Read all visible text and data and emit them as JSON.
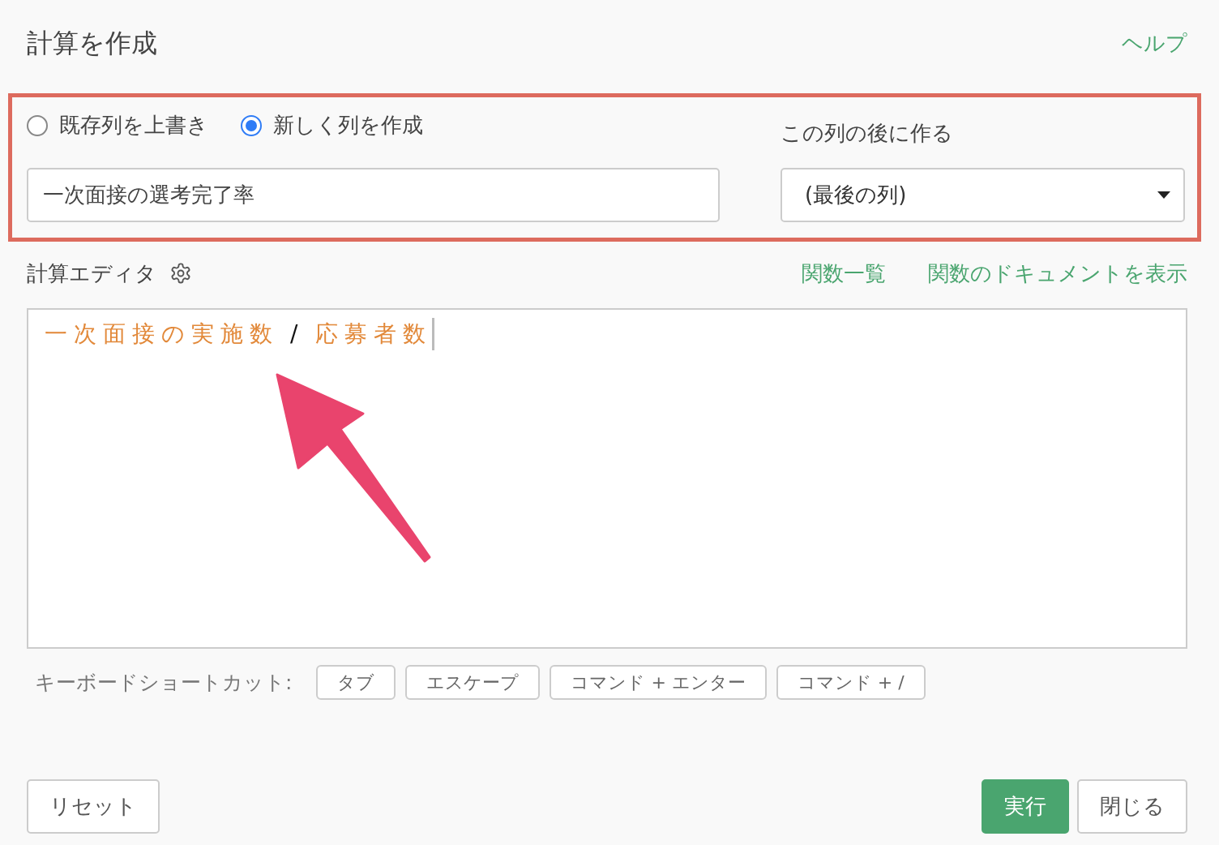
{
  "dialog": {
    "title": "計算を作成",
    "help_link": "ヘルプ"
  },
  "column_mode": [
    {
      "label": "既存列を上書き",
      "selected": false
    },
    {
      "label": "新しく列を作成",
      "selected": true
    }
  ],
  "column_name": {
    "value": "一次面接の選考完了率"
  },
  "position": {
    "label": "この列の後に作る",
    "value": "(最後の列)"
  },
  "editor": {
    "label": "計算エディタ",
    "links": [
      "関数一覧",
      "関数のドキュメントを表示"
    ],
    "tokens": [
      {
        "kind": "field",
        "text": "一次面接の実施数"
      },
      {
        "kind": "operator",
        "text": "/"
      },
      {
        "kind": "field",
        "text": "応募者数"
      }
    ]
  },
  "shortcuts": {
    "label": "キーボードショートカット:",
    "keys": [
      "タブ",
      "エスケープ",
      "コマンド + エンター",
      "コマンド + /"
    ]
  },
  "buttons": [
    {
      "kind": "secondary",
      "label": "リセット"
    },
    {
      "kind": "primary",
      "label": "実行"
    },
    {
      "kind": "secondary",
      "label": "閉じる"
    }
  ]
}
